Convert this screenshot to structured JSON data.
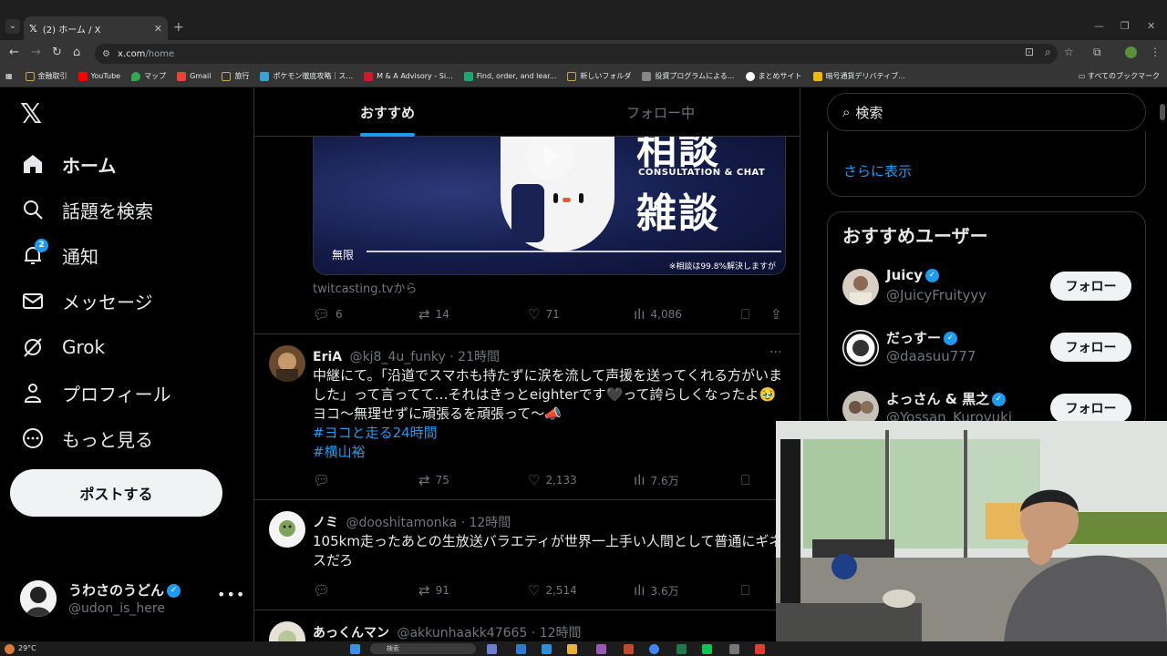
{
  "browser": {
    "tab_title": "(2) ホーム / X",
    "url_host": "x.com",
    "url_path": "/home",
    "bookmarks": [
      {
        "label": "金融取引",
        "color": "#c7a64a"
      },
      {
        "label": "YouTube",
        "color": "#ff0000"
      },
      {
        "label": "マップ",
        "color": "#34a853"
      },
      {
        "label": "Gmail",
        "color": "#ea4335"
      },
      {
        "label": "旅行",
        "color": "#c7a64a"
      },
      {
        "label": "ポケモン徹底攻略｜ス...",
        "color": "#3aa0d8"
      },
      {
        "label": "M & A Advisory - Si...",
        "color": "#d3182b"
      },
      {
        "label": "Find, order, and lear...",
        "color": "#19a974"
      },
      {
        "label": "新しいフォルダ",
        "color": "#c7a64a"
      },
      {
        "label": "投資プログラムによる...",
        "color": "#888888"
      },
      {
        "label": "まとめサイト",
        "color": "#ffffff"
      },
      {
        "label": "暗号通貨デリバティブ...",
        "color": "#f0b90b"
      }
    ],
    "all_bookmarks": "すべてのブックマーク"
  },
  "nav": {
    "items": [
      {
        "label": "ホーム",
        "icon": "home-icon"
      },
      {
        "label": "話題を検索",
        "icon": "search-icon"
      },
      {
        "label": "通知",
        "icon": "bell-icon",
        "badge": "2"
      },
      {
        "label": "メッセージ",
        "icon": "envelope-icon"
      },
      {
        "label": "Grok",
        "icon": "grok-icon"
      },
      {
        "label": "プロフィール",
        "icon": "person-icon"
      },
      {
        "label": "もっと見る",
        "icon": "more-circle-icon"
      }
    ],
    "post_button": "ポストする",
    "account": {
      "name": "うわさのうどん",
      "handle": "@udon_is_here",
      "more": "•••"
    }
  },
  "timeline": {
    "tabs": [
      "おすすめ",
      "フォロー中"
    ],
    "media": {
      "kanji_top": "相談",
      "subtitle": "CONSULTATION & CHAT",
      "kanji_bottom": "雑談",
      "badge": "無限",
      "note": "※相談は99.8%解決しますが"
    },
    "source": "twitcasting.tvから",
    "first_actions": {
      "replies": "6",
      "reposts": "14",
      "likes": "71",
      "views": "4,086"
    },
    "tweets": [
      {
        "name": "EriA",
        "handle": "@kj8_4u_funky",
        "time": "· 21時間",
        "text": "中継にて。「沿道でスマホも持たずに涙を流して声援を送ってくれる方がいました」って言ってて…それはきっとeighterです🖤って誇らしくなったよ🥹ヨコ〜無理せずに頑張るを頑張って〜📣",
        "hashtags": [
          "#ヨコと走る24時間",
          "#横山裕"
        ],
        "reposts": "75",
        "likes": "2,133",
        "views": "7.6万"
      },
      {
        "name": "ノミ",
        "handle": "@dooshitamonka",
        "time": "· 12時間",
        "text": "105km走ったあとの生放送バラエティが世界一上手い人間として普通にギネスだろ",
        "reposts": "91",
        "likes": "2,514",
        "views": "3.6万"
      },
      {
        "name": "あっくんマン",
        "handle": "@akkunhaakk47665",
        "time": "· 12時間"
      }
    ]
  },
  "right": {
    "search_placeholder": "検索",
    "show_more": "さらに表示",
    "who_to_follow_title": "おすすめユーザー",
    "users": [
      {
        "name": "Juicy",
        "handle": "@JuicyFruityyy",
        "button": "フォロー"
      },
      {
        "name": "だっすー",
        "handle": "@daasuu777",
        "button": "フォロー"
      },
      {
        "name": "よっさん & 黒之",
        "handle": "@Yossan_Kurovuki",
        "button": "フォロー"
      }
    ]
  },
  "taskbar": {
    "weather": "29°C",
    "search": "検索"
  }
}
